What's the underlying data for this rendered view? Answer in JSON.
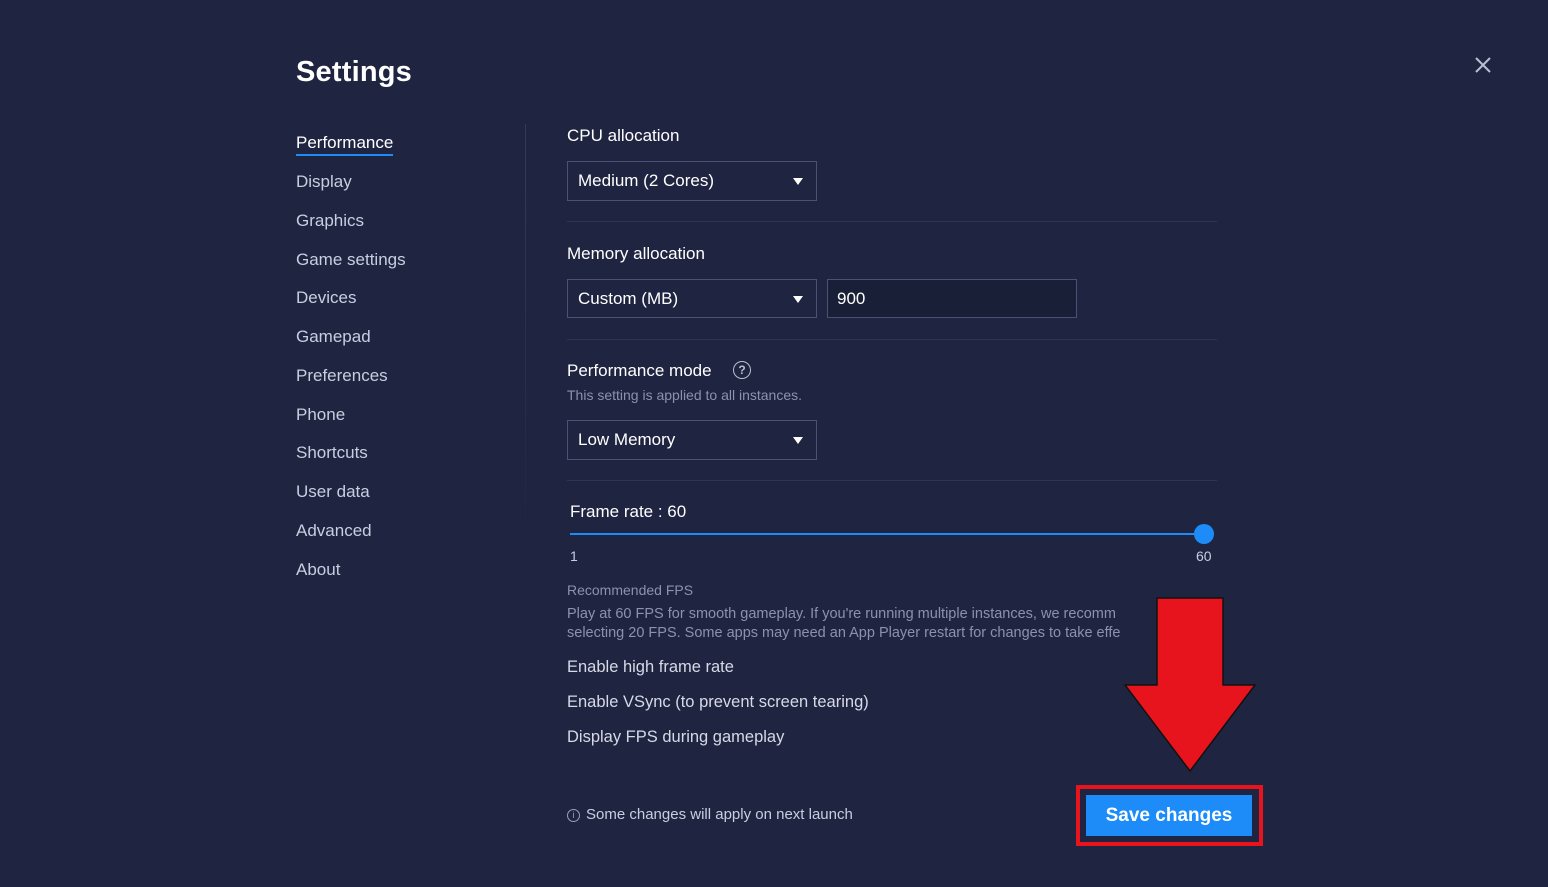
{
  "header": {
    "title": "Settings"
  },
  "nav": {
    "items": [
      {
        "label": "Performance",
        "active": true
      },
      {
        "label": "Display"
      },
      {
        "label": "Graphics"
      },
      {
        "label": "Game settings"
      },
      {
        "label": "Devices"
      },
      {
        "label": "Gamepad"
      },
      {
        "label": "Preferences"
      },
      {
        "label": "Phone"
      },
      {
        "label": "Shortcuts"
      },
      {
        "label": "User data"
      },
      {
        "label": "Advanced"
      },
      {
        "label": "About"
      }
    ]
  },
  "cpu": {
    "label": "CPU allocation",
    "value": "Medium (2 Cores)"
  },
  "memory": {
    "label": "Memory allocation",
    "value": "Custom (MB)",
    "custom_value": "900"
  },
  "perf_mode": {
    "label": "Performance mode",
    "hint": "This setting is applied to all instances.",
    "value": "Low Memory"
  },
  "frame_rate": {
    "label": "Frame rate : 60",
    "value": 60,
    "min": "1",
    "max": "60",
    "recommended_title": "Recommended FPS",
    "recommended_line1": "Play at 60 FPS for smooth gameplay. If you're running multiple instances, we recomm",
    "recommended_line2": "selecting 20 FPS. Some apps may need an App Player restart for changes to take effe"
  },
  "options": {
    "high_frame_rate": "Enable high frame rate",
    "vsync": "Enable VSync (to prevent screen tearing)",
    "display_fps": "Display FPS during gameplay"
  },
  "footer": {
    "note": "Some changes will apply on next launch",
    "save_label": "Save changes"
  },
  "colors": {
    "background": "#1f2541",
    "accent": "#1d8cf8",
    "annotation": "#e8141d"
  },
  "icons": {
    "close": "close-icon",
    "help": "help-icon",
    "info": "info-icon",
    "caret": "chevron-down-icon"
  }
}
